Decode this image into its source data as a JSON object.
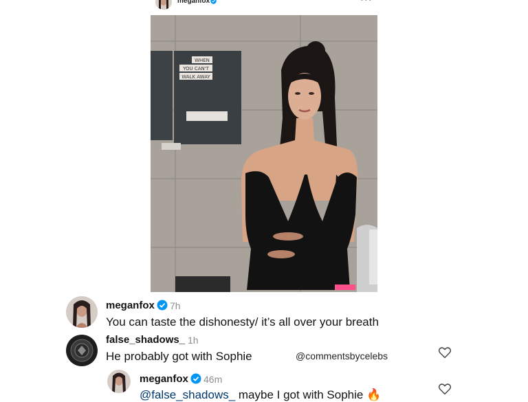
{
  "post": {
    "username": "meganfox",
    "more_icon": "•••",
    "verified_icon": "verified-badge-icon",
    "poster_text": [
      "WHEN",
      "YOU CAN'T",
      "WALK AWAY"
    ]
  },
  "comments": [
    {
      "username": "meganfox",
      "time": "7h",
      "text": "You can taste the dishonesty/ it’s all over your breath",
      "verified": true
    },
    {
      "username": "false_shadows_",
      "time": "1h",
      "text": "He probably got with Sophie",
      "verified": false
    },
    {
      "username": "meganfox",
      "time": "46m",
      "mention": "@false_shadows_",
      "text": " maybe I got with Sophie",
      "emoji": "🔥",
      "verified": true
    }
  ],
  "watermark": "@commentsbycelebs",
  "colors": {
    "verified_blue": "#0095f6",
    "time_gray": "#8e8e8e",
    "mention_blue": "#00376b"
  }
}
